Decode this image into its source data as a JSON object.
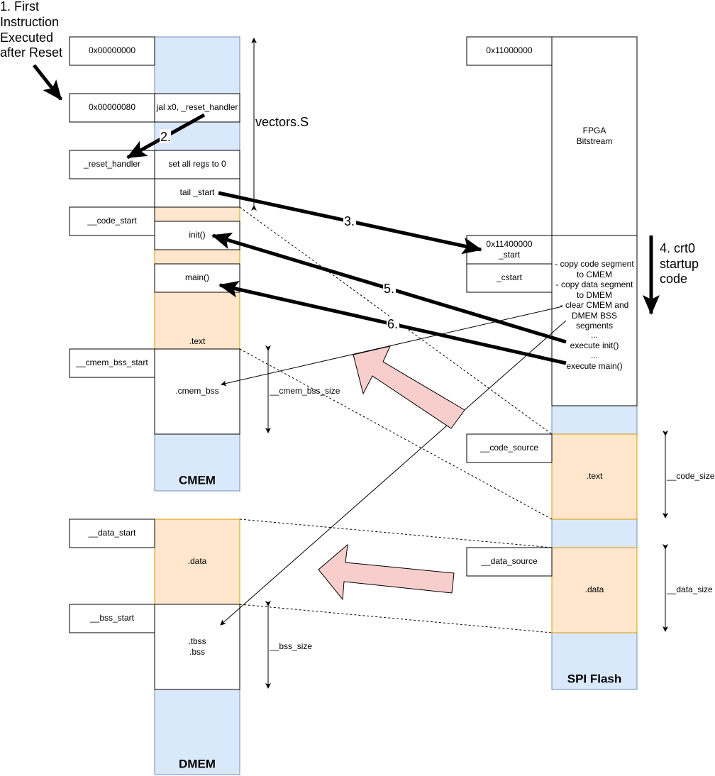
{
  "annotations": {
    "step1": [
      "1. First",
      "Instruction",
      "Executed",
      "after Reset"
    ],
    "step2": "2.",
    "step3": "3.",
    "step4": [
      "4. crt0",
      "startup",
      "code"
    ],
    "step5": "5.",
    "step6": "6.",
    "vectors": "vectors.S"
  },
  "cmem": {
    "title": "CMEM",
    "labels": {
      "addr0": "0x00000000",
      "addr80": "0x00000080",
      "reset_handler": "_reset_handler",
      "code_start": "__code_start",
      "cmem_bss_start": "__cmem_bss_start"
    },
    "cells": {
      "jal": "jal x0, _reset_handler",
      "set_regs": "set all regs to 0",
      "tail_start": "tail _start",
      "init": "init()",
      "main": "main()",
      "text": ".text",
      "cmem_bss": ".cmem_bss"
    },
    "size_label": "__cmem_bss_size"
  },
  "dmem": {
    "title": "DMEM",
    "labels": {
      "data_start": "__data_start",
      "bss_start": "__bss_start"
    },
    "cells": {
      "data": ".data",
      "bss": [
        ".tbss",
        ".bss"
      ]
    },
    "size_label": "__bss_size"
  },
  "flash": {
    "title": "SPI Flash",
    "labels": {
      "addr": "0x11000000",
      "start": [
        "0x11400000",
        "_start"
      ],
      "cstart": "_cstart",
      "code_source": "__code_source",
      "data_source": "__data_source"
    },
    "cells": {
      "bitstream": [
        "FPGA",
        "Bitstream"
      ],
      "crt0": [
        "- copy code segment",
        "to CMEM",
        "- copy data segment",
        "to DMEM",
        "- clear CMEM and",
        "DMEM BSS",
        "segments",
        "...",
        "execute init()",
        "...",
        "execute main()"
      ],
      "text": ".text",
      "data": ".data"
    },
    "code_size": "__code_size",
    "data_size": "__data_size"
  },
  "colors": {
    "blue": "#dae8fc",
    "orange": "#ffe6cc",
    "pink": "#f8cecc"
  }
}
